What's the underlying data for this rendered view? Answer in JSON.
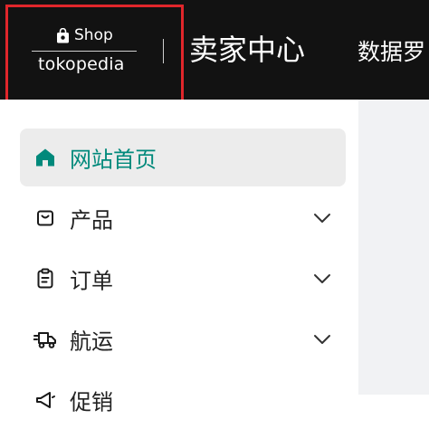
{
  "header": {
    "logo_shop": "Shop",
    "logo_brand": "tokopedia",
    "title": "卖家中心",
    "nav_link": "数据罗"
  },
  "sidebar": {
    "items": [
      {
        "label": "网站首页",
        "icon": "home-icon",
        "active": true
      },
      {
        "label": "产品",
        "icon": "product-icon",
        "active": false,
        "expandable": true
      },
      {
        "label": "订单",
        "icon": "clipboard-icon",
        "active": false,
        "expandable": true
      },
      {
        "label": "航运",
        "icon": "delivery-truck-icon",
        "active": false,
        "expandable": true
      },
      {
        "label": "促销",
        "icon": "megaphone-icon",
        "active": false
      }
    ]
  },
  "colors": {
    "header_bg": "#121212",
    "accent": "#00897b",
    "highlight_border": "#e0262b",
    "active_item_bg": "#ececec",
    "content_bg": "#f1f2f4"
  }
}
